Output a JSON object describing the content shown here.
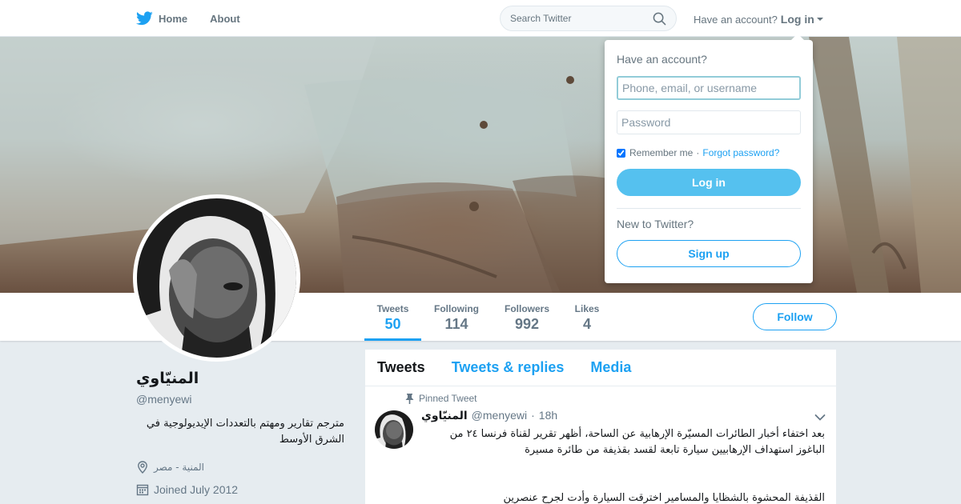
{
  "nav": {
    "home_label": "Home",
    "about_label": "About",
    "search_placeholder": "Search Twitter",
    "have_account_text": "Have an account?",
    "login_link": "Log in"
  },
  "login_dropdown": {
    "title": "Have an account?",
    "username_placeholder": "Phone, email, or username",
    "password_placeholder": "Password",
    "remember_label": "Remember me",
    "separator": "·",
    "forgot_label": "Forgot password?",
    "login_button": "Log in",
    "new_text": "New to Twitter?",
    "signup_button": "Sign up"
  },
  "stats": [
    {
      "label": "Tweets",
      "value": "50"
    },
    {
      "label": "Following",
      "value": "114"
    },
    {
      "label": "Followers",
      "value": "992"
    },
    {
      "label": "Likes",
      "value": "4"
    }
  ],
  "follow_button": "Follow",
  "profile": {
    "name": "المنيّاوي",
    "handle": "@menyewi",
    "bio": "مترجم تقارير ومهتم بالتعددات الإيديولوجية في الشرق الأوسط",
    "location": "المنية - مصر",
    "joined": "Joined July 2012"
  },
  "timeline": {
    "tabs": [
      "Tweets",
      "Tweets & replies",
      "Media"
    ],
    "pinned_label": "Pinned Tweet",
    "tweet": {
      "name": "المنيّاوي",
      "handle": "@menyewi",
      "separator": "·",
      "time": "18h",
      "text": "بعد اختفاء أخبار الطائرات المسيّرة الإرهابية عن الساحة، أظهر تقرير لقناة فرنسا ٢٤ من الباغوز استهداف الإرهابيين سيارة تابعة لقسد بقذيفة من طائرة مسيرة",
      "text2": "القذيفة المحشوة بالشظايا والمسامير اخترقت السيارة وأدت لجرح عنصرين"
    }
  },
  "colors": {
    "accent": "#1da1f2",
    "login_button_bg": "#55c1ef",
    "page_bg": "#e6ecf0"
  },
  "icons": [
    "twitter-bird-icon",
    "search-icon",
    "caret-down-icon",
    "location-pin-icon",
    "calendar-icon",
    "pin-icon",
    "chevron-down-icon"
  ]
}
